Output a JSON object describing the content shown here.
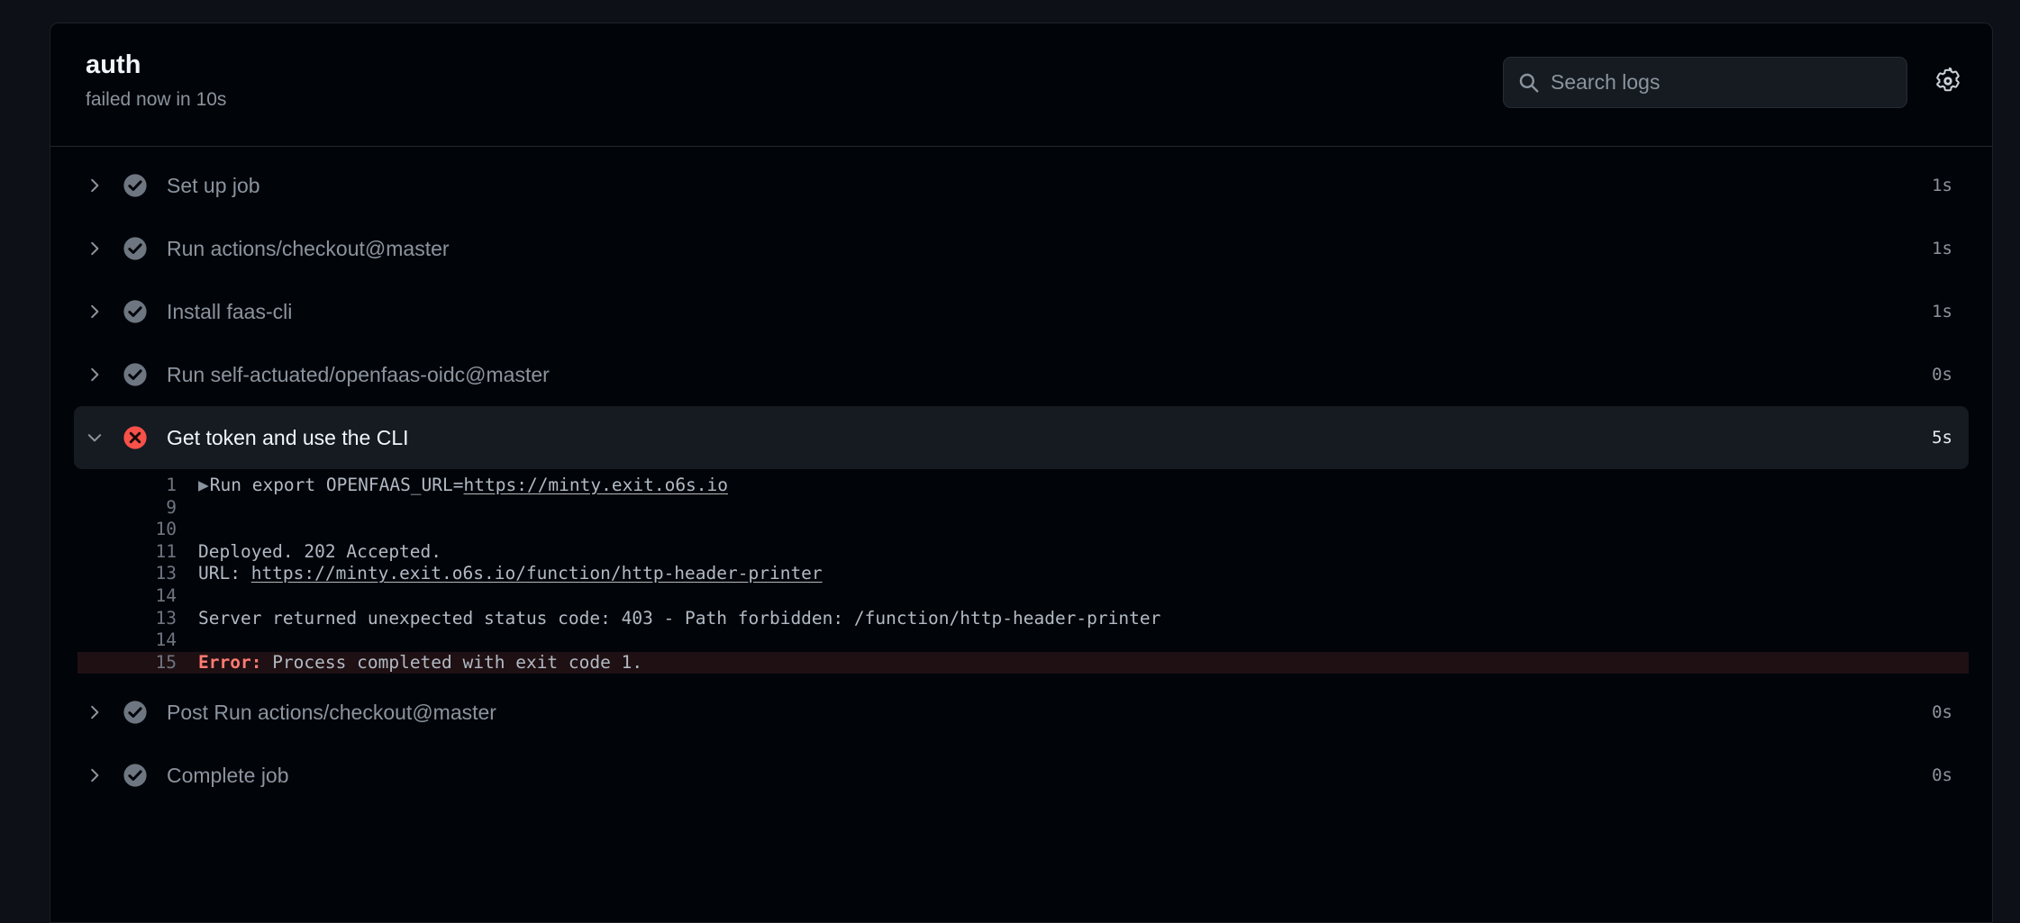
{
  "header": {
    "job_title": "auth",
    "job_status": "failed now in 10s",
    "search": {
      "placeholder": "Search logs",
      "value": "",
      "icon": "search-icon"
    },
    "settings_icon": "gear-icon"
  },
  "colors": {
    "page_background": "#0d1117",
    "panel_background": "#010409",
    "expanded_row_background": "#161b22",
    "error_line_background": "#1f1013",
    "success_icon": "#6e7681",
    "failure_icon": "#f85149",
    "error_text": "#ff7b72",
    "muted_text": "#8b949e",
    "bright_text": "#f0f6fc"
  },
  "steps": [
    {
      "label": "Set up job",
      "status": "success",
      "status_icon": "check-circle-icon",
      "duration": "1s",
      "expanded": false,
      "chevron": "chevron-right-icon"
    },
    {
      "label": "Run actions/checkout@master",
      "status": "success",
      "status_icon": "check-circle-icon",
      "duration": "1s",
      "expanded": false,
      "chevron": "chevron-right-icon"
    },
    {
      "label": "Install faas-cli",
      "status": "success",
      "status_icon": "check-circle-icon",
      "duration": "1s",
      "expanded": false,
      "chevron": "chevron-right-icon"
    },
    {
      "label": "Run self-actuated/openfaas-oidc@master",
      "status": "success",
      "status_icon": "check-circle-icon",
      "duration": "0s",
      "expanded": false,
      "chevron": "chevron-right-icon"
    },
    {
      "label": "Get token and use the CLI",
      "status": "failure",
      "status_icon": "x-circle-icon",
      "duration": "5s",
      "expanded": true,
      "chevron": "chevron-down-icon"
    },
    {
      "label": "Post Run actions/checkout@master",
      "status": "success",
      "status_icon": "check-circle-icon",
      "duration": "0s",
      "expanded": false,
      "chevron": "chevron-right-icon"
    },
    {
      "label": "Complete job",
      "status": "success",
      "status_icon": "check-circle-icon",
      "duration": "0s",
      "expanded": false,
      "chevron": "chevron-right-icon"
    }
  ],
  "log_lines": [
    {
      "number": "1",
      "fold": "▶",
      "text": "Run export OPENFAAS_URL=",
      "link": "https://minty.exit.o6s.io",
      "error": false
    },
    {
      "number": "9",
      "text": "",
      "error": false
    },
    {
      "number": "10",
      "text": "",
      "error": false
    },
    {
      "number": "11",
      "text": "Deployed. 202 Accepted.",
      "error": false
    },
    {
      "number": "13",
      "text": "URL: ",
      "link": "https://minty.exit.o6s.io/function/http-header-printer",
      "error": false
    },
    {
      "number": "14",
      "text": "",
      "error": false
    },
    {
      "number": "13",
      "text": "Server returned unexpected status code: 403 - Path forbidden: /function/http-header-printer",
      "error": false
    },
    {
      "number": "14",
      "text": "",
      "error": false
    },
    {
      "number": "15",
      "tag": "Error:",
      "text": " Process completed with exit code 1.",
      "error": true
    }
  ]
}
